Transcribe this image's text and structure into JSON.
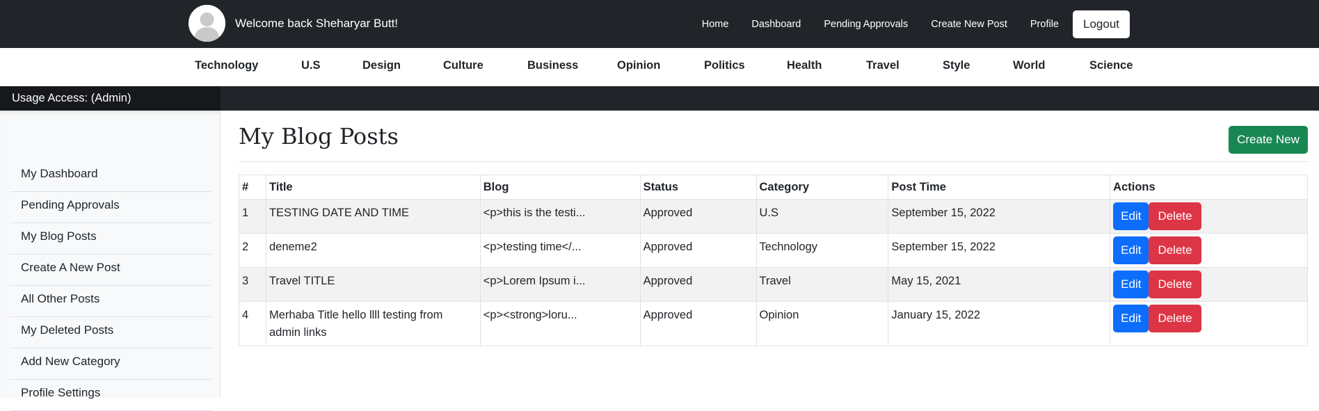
{
  "header": {
    "welcome": "Welcome back Sheharyar Butt!",
    "nav": [
      "Home",
      "Dashboard",
      "Pending Approvals",
      "Create New Post",
      "Profile"
    ],
    "logout_label": "Logout"
  },
  "categories": [
    "Technology",
    "U.S",
    "Design",
    "Culture",
    "Business",
    "Opinion",
    "Politics",
    "Health",
    "Travel",
    "Style",
    "World",
    "Science"
  ],
  "usage_access": "Usage Access: (Admin)",
  "sidebar": {
    "items": [
      "My Dashboard",
      "Pending Approvals",
      "My Blog Posts",
      "Create A New Post",
      "All Other Posts",
      "My Deleted Posts",
      "Add New Category",
      "Profile Settings"
    ]
  },
  "main": {
    "title": "My Blog Posts",
    "create_label": "Create New",
    "table": {
      "headers": [
        "#",
        "Title",
        "Blog",
        "Status",
        "Category",
        "Post Time",
        "Actions"
      ],
      "rows": [
        {
          "num": "1",
          "title": "TESTING DATE AND TIME",
          "blog": "<p>this is the testi...",
          "status": "Approved",
          "category": "U.S",
          "time": "September 15, 2022"
        },
        {
          "num": "2",
          "title": "deneme2",
          "blog": "<p>testing time</...",
          "status": "Approved",
          "category": "Technology",
          "time": "September 15, 2022"
        },
        {
          "num": "3",
          "title": "Travel TITLE",
          "blog": "<p>Lorem Ipsum i...",
          "status": "Approved",
          "category": "Travel",
          "time": "May 15, 2021"
        },
        {
          "num": "4",
          "title": "Merhaba Title hello llll testing from admin links",
          "blog": "<p><strong>loru...",
          "status": "Approved",
          "category": "Opinion",
          "time": "January 15, 2022"
        }
      ],
      "edit_label": "Edit",
      "delete_label": "Delete"
    }
  },
  "colors": {
    "navbar": "#212529",
    "create_button": "#198754",
    "edit_button": "#0d6efd",
    "delete_button": "#dc3545"
  },
  "icons": {
    "avatar": "user-avatar-icon"
  }
}
